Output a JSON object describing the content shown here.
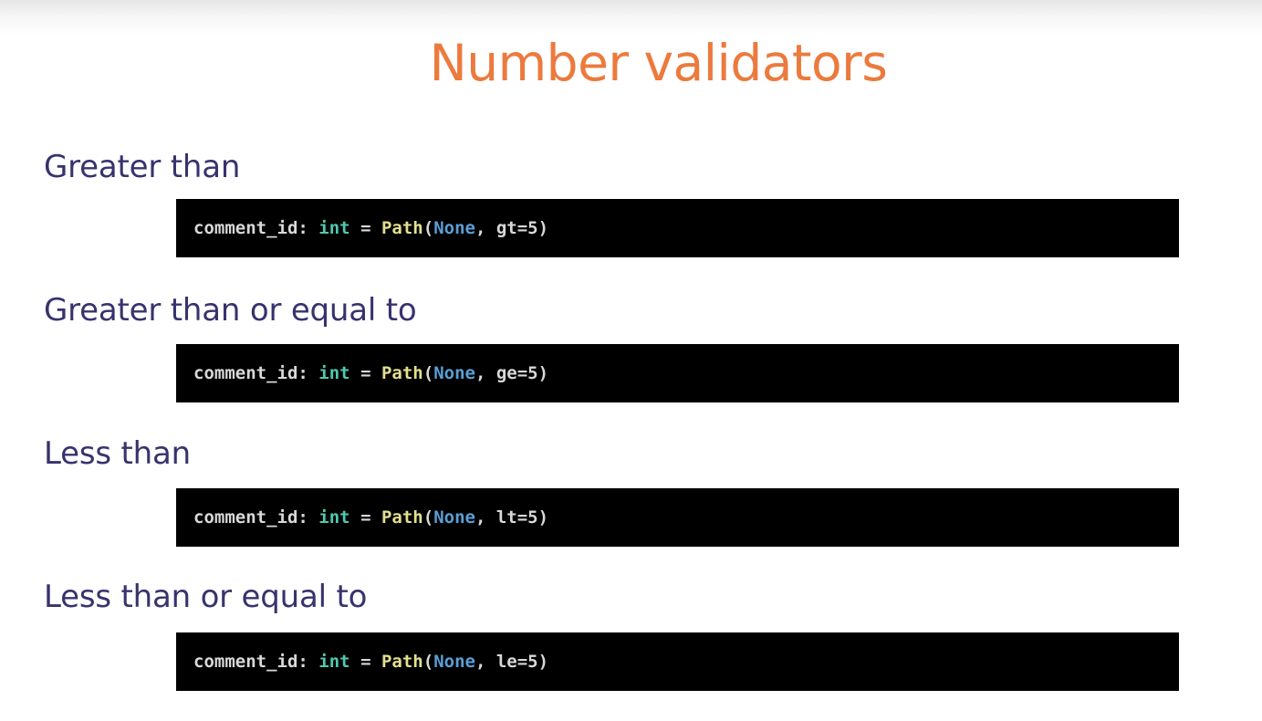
{
  "slide": {
    "title": "Number validators",
    "colors": {
      "title": "#ec7a3d",
      "heading": "#37336d",
      "code_background": "#000000",
      "code_type": "#4ec9b0",
      "code_function": "#e3e08f",
      "code_keyword": "#5a9fd6",
      "code_text": "#d8d8d8"
    }
  },
  "sections": [
    {
      "heading": "Greater than",
      "code": {
        "var": "comment_id:",
        "type": "int",
        "op": "=",
        "fn": "Path",
        "open": "(",
        "kw": "None",
        "rest": ", gt=5)"
      }
    },
    {
      "heading": "Greater than or equal to",
      "code": {
        "var": "comment_id:",
        "type": "int",
        "op": "=",
        "fn": "Path",
        "open": "(",
        "kw": "None",
        "rest": ", ge=5)"
      }
    },
    {
      "heading": "Less than",
      "code": {
        "var": "comment_id:",
        "type": "int",
        "op": "=",
        "fn": "Path",
        "open": "(",
        "kw": "None",
        "rest": ", lt=5)"
      }
    },
    {
      "heading": "Less than or equal to",
      "code": {
        "var": "comment_id:",
        "type": "int",
        "op": "=",
        "fn": "Path",
        "open": "(",
        "kw": "None",
        "rest": ", le=5)"
      }
    }
  ]
}
